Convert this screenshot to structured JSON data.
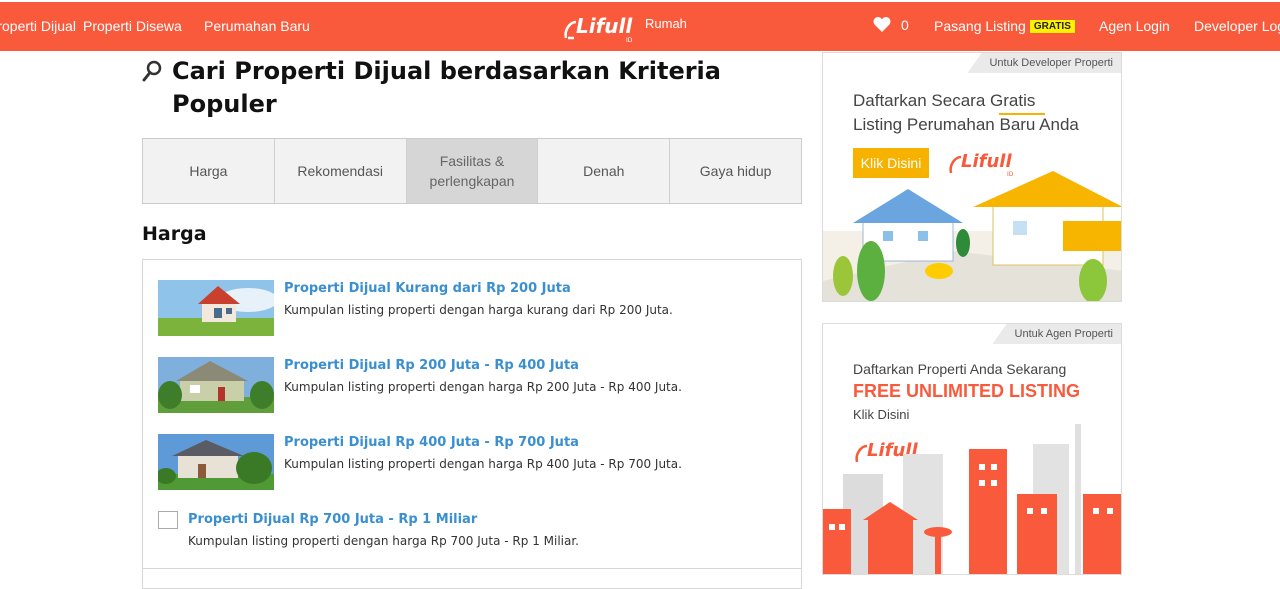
{
  "nav": {
    "left_items": [
      "Properti Dijual",
      "Properti Disewa",
      "Perumahan Baru"
    ],
    "logo_sub": "Rumah",
    "favorites_count": "0",
    "pasang_listing": "Pasang Listing",
    "gratis_badge": "GRATIS",
    "agen_login": "Agen Login",
    "developer_login": "Developer Login"
  },
  "page": {
    "title": "Cari Properti Dijual berdasarkan Kriteria Populer"
  },
  "tabs": [
    {
      "label": "Harga",
      "active": false
    },
    {
      "label": "Rekomendasi",
      "active": false
    },
    {
      "label": "Fasilitas & perlengkapan",
      "active": true
    },
    {
      "label": "Denah",
      "active": false
    },
    {
      "label": "Gaya hidup",
      "active": false
    }
  ],
  "section": {
    "title": "Harga",
    "items": [
      {
        "link": "Properti Dijual Kurang dari Rp 200 Juta",
        "desc": "Kumpulan listing properti dengan harga kurang dari Rp 200 Juta."
      },
      {
        "link": "Properti Dijual Rp 200 Juta - Rp 400 Juta",
        "desc": "Kumpulan listing properti dengan harga Rp 200 Juta - Rp 400 Juta."
      },
      {
        "link": "Properti Dijual Rp 400 Juta - Rp 700 Juta",
        "desc": "Kumpulan listing properti dengan harga Rp 400 Juta - Rp 700 Juta."
      },
      {
        "link": "Properti Dijual Rp 700 Juta - Rp 1 Miliar",
        "desc": "Kumpulan listing properti dengan harga Rp 700 Juta - Rp 1 Miliar."
      }
    ]
  },
  "ads": {
    "developer": {
      "tag": "Untuk Developer Properti",
      "line1": "Daftarkan Secara Gratis",
      "line2": "Listing Perumahan Baru Anda",
      "button": "Klik Disini"
    },
    "agent": {
      "tag": "Untuk Agen Properti",
      "line1": "Daftarkan Properti Anda Sekarang",
      "line2": "FREE UNLIMITED LISTING",
      "line3": "Klik Disini"
    }
  },
  "colors": {
    "brand": "#f95a3c",
    "link": "#3a8fd0",
    "badge": "#fef200",
    "ad_button": "#f7b200"
  }
}
